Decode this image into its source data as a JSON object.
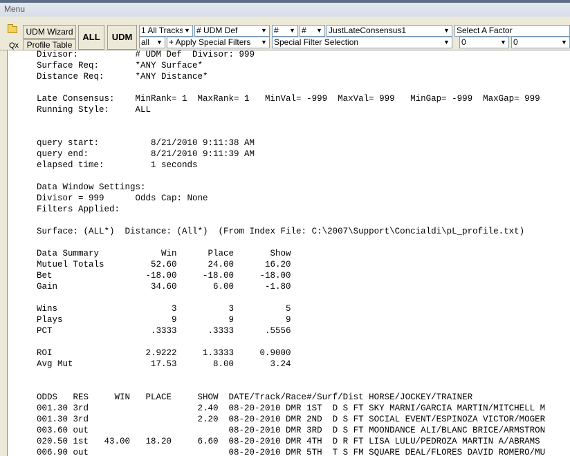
{
  "window": {
    "menu_label": "Menu"
  },
  "toolbar": {
    "udm_wizard_label": "UDM Wizard",
    "profile_table_label": "Profile Table",
    "all_label": "ALL",
    "udm_label": "UDM",
    "qx_label": "Qx",
    "tracks": "1 All Tracks",
    "udm_def": "# UDM Def",
    "hash1": "#",
    "hash2": "#",
    "consensus": "JustLateConsensus1",
    "factor": "Select A Factor",
    "all_select": "all",
    "apply_filters": "+ Apply Special Filters",
    "special_filter": "Special Filter Selection",
    "zero1": "0",
    "zero2": "0"
  },
  "report": {
    "lines": [
      "Divisor:           # UDM Def  Divisor: 999",
      "Surface Req:       *ANY Surface*",
      "Distance Req:      *ANY Distance*",
      "",
      "Late Consensus:    MinRank= 1  MaxRank= 1   MinVal= -999  MaxVal= 999   MinGap= -999  MaxGap= 999",
      "Running Style:     ALL",
      "",
      "",
      "query start:          8/21/2010 9:11:38 AM",
      "query end:            8/21/2010 9:11:39 AM",
      "elapsed time:         1 seconds",
      "",
      "Data Window Settings:",
      "Divisor = 999      Odds Cap: None",
      "Filters Applied:",
      "",
      "Surface: (ALL*)  Distance: (All*)  (From Index File: C:\\2007\\Support\\Concialdi\\pL_profile.txt)",
      "",
      "Data Summary            Win      Place       Show",
      "Mutuel Totals         52.60      24.00      16.20",
      "Bet                  -18.00     -18.00     -18.00",
      "Gain                  34.60       6.00      -1.80",
      "",
      "Wins                      3          3          5",
      "Plays                     9          9          9",
      "PCT                   .3333      .3333      .5556",
      "",
      "ROI                  2.9222     1.3333     0.9000",
      "Avg Mut               17.53       8.00       3.24",
      "",
      "",
      "ODDS   RES     WIN   PLACE     SHOW  DATE/Track/Race#/Surf/Dist HORSE/JOCKEY/TRAINER",
      "001.30 3rd                     2.40  08-20-2010 DMR 1ST  D S FT SKY MARNI/GARCIA MARTIN/MITCHELL M",
      "001.30 3rd                     2.20  08-20-2010 DMR 2ND  D S FT SOCIAL EVENT/ESPINOZA VICTOR/MOGER",
      "003.60 out                           08-20-2010 DMR 3RD  D S FT MOONDANCE ALI/BLANC BRICE/ARMSTRON",
      "020.50 1st   43.00   18.20     6.60  08-20-2010 DMR 4TH  D R FT LISA LULU/PEDROZA MARTIN A/ABRAMS",
      "006.90 out                           08-20-2010 DMR 5TH  T S FM SQUARE DEAL/FLORES DAVID ROMERO/MU"
    ]
  }
}
